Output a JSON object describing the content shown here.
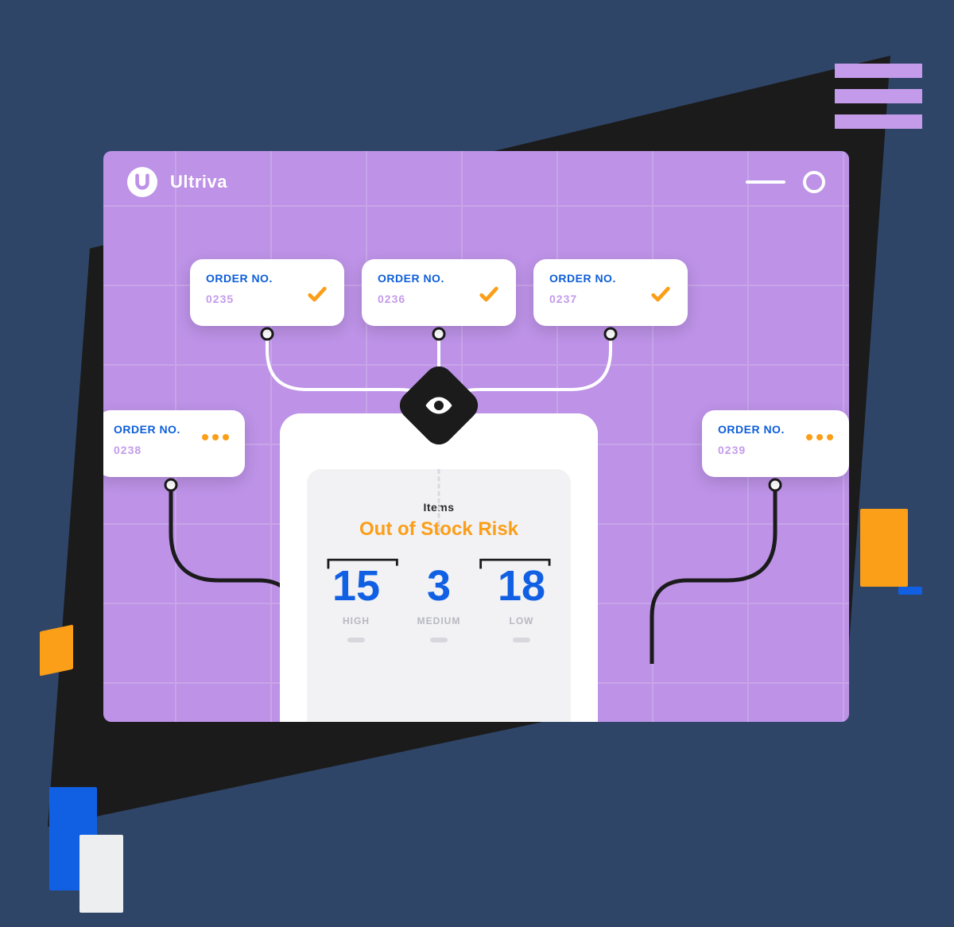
{
  "header": {
    "app_title": "Ultriva"
  },
  "orders": [
    {
      "label": "ORDER NO.",
      "value": "0235",
      "status": "done"
    },
    {
      "label": "ORDER NO.",
      "value": "0236",
      "status": "done"
    },
    {
      "label": "ORDER NO.",
      "value": "0237",
      "status": "done"
    },
    {
      "label": "ORDER NO.",
      "value": "0238",
      "status": "pending"
    },
    {
      "label": "ORDER NO.",
      "value": "0239",
      "status": "pending"
    }
  ],
  "risk_panel": {
    "items_label": "Items",
    "title": "Out of Stock Risk",
    "levels": [
      {
        "count": "15",
        "label": "HIGH"
      },
      {
        "count": "3",
        "label": "MEDIUM"
      },
      {
        "count": "18",
        "label": "LOW"
      }
    ]
  },
  "colors": {
    "accent_orange": "#fb9e18",
    "accent_blue": "#1160e4",
    "lilac": "#bd92e7"
  }
}
